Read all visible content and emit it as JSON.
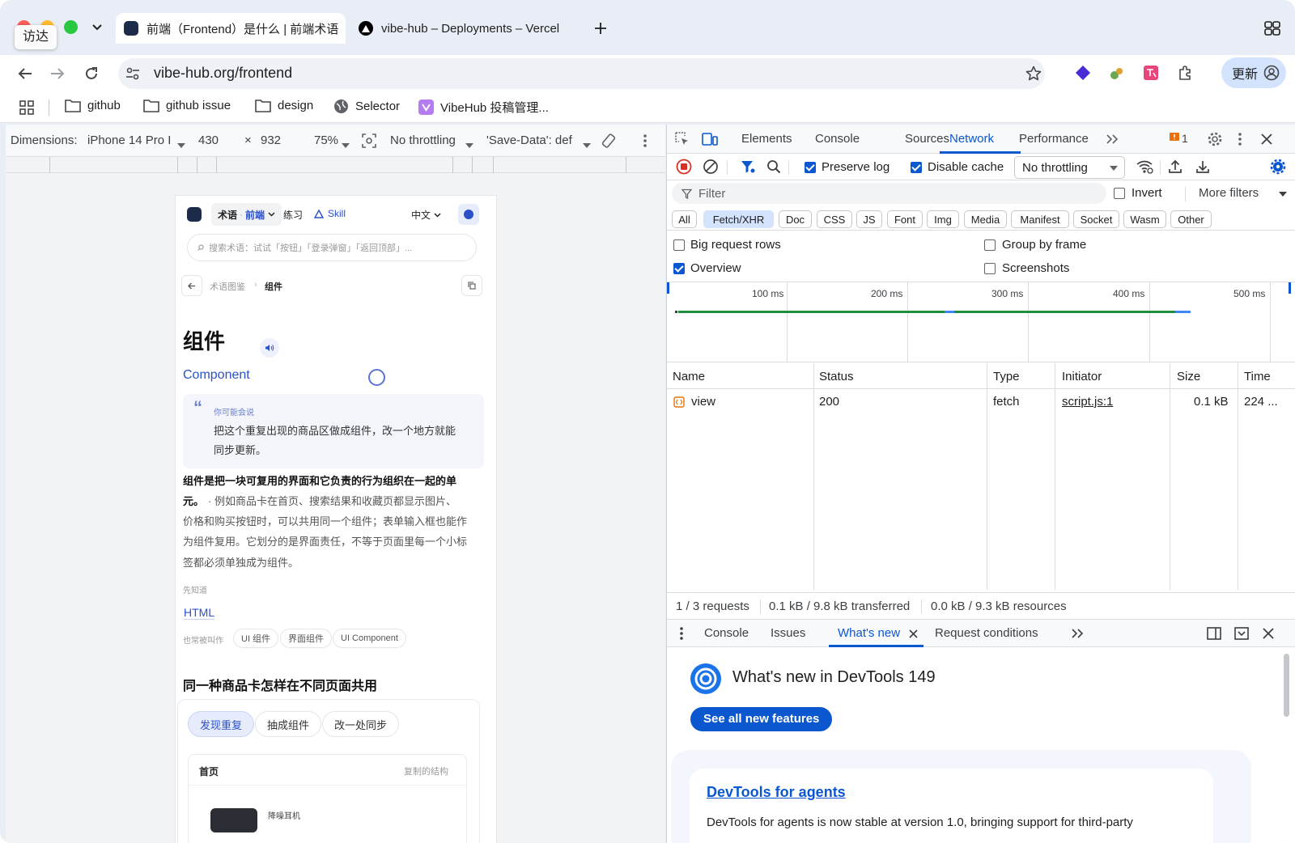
{
  "colors": {
    "accent": "#0b57d0",
    "close_red": "#ff5f57",
    "minimize_yellow": "#febc2e",
    "maximize_green": "#28c840",
    "record_red": "#d93025",
    "waterfall_green": "#1e8e3e"
  },
  "macos": {
    "finder_tooltip": "访达"
  },
  "tabs": [
    {
      "title": "前端（Frontend）是什么 | 前端术语",
      "icon": "vibehub-logo-icon"
    },
    {
      "title": "vibe-hub – Deployments – Vercel",
      "icon": "vercel-triangle-icon"
    }
  ],
  "toolbar": {
    "url": "vibe-hub.org/frontend",
    "update_label": "更新"
  },
  "bookmarks": [
    {
      "label": "github",
      "icon": "folder-icon"
    },
    {
      "label": "github issue",
      "icon": "folder-icon"
    },
    {
      "label": "design",
      "icon": "folder-icon"
    },
    {
      "label": "Selector",
      "icon": "globe-icon"
    },
    {
      "label": "VibeHub 投稿管理...",
      "icon": "vibehub-logo-icon"
    }
  ],
  "device_toolbar": {
    "dimensions_label": "Dimensions:",
    "device": "iPhone 14 Pro I",
    "width": "430",
    "times": "×",
    "height": "932",
    "zoom": "75%",
    "throttling": "No throttling",
    "save_data": "'Save-Data': def"
  },
  "device_page": {
    "nav_term": "术语",
    "nav_dot": "·",
    "nav_category": "前端",
    "nav_practice": "练习",
    "nav_skill": "Skill",
    "lang": "中文",
    "search_placeholder": "搜索术语：试试「按钮」「登录弹窗」「返回顶部」...",
    "breadcrumb_parent": "术语图鉴",
    "breadcrumb_sep": "›",
    "breadcrumb_current": "组件",
    "title": "组件",
    "english": "Component",
    "quote_mark": "“",
    "quote_label": "你可能会说",
    "quote_line1": "把这个重复出现的商品区做成组件，改一个地方就能",
    "quote_line2": "同步更新。",
    "def_bold1": "组件是把一块可复用的界面和它负责的行为组织在一起的单",
    "def_bold2": "元。",
    "def_line2_rest": "· 例如商品卡在首页、搜索结果和收藏页都显示图片、",
    "def_line3": "价格和购买按钮时，可以共用同一个组件；表单输入框也能作",
    "def_line4": "为组件复用。它划分的是界面责任，不等于页面里每一个小标",
    "def_line5": "签都必须单独成为组件。",
    "prereq_label": "先知道",
    "prereq_link": "HTML",
    "aka_label": "也常被叫作",
    "aka_chips": [
      "UI 组件",
      "界面组件",
      "UI Component"
    ],
    "section_title": "同一种商品卡怎样在不同页面共用",
    "steps": [
      "发现重复",
      "抽成组件",
      "改一处同步"
    ],
    "card_title": "首页",
    "card_note": "复制的结构",
    "card_item": "降噪耳机"
  },
  "devtools": {
    "tabs": [
      "Elements",
      "Console",
      "Sources",
      "Network",
      "Performance"
    ],
    "active_tab": "Network",
    "issues_count": "1",
    "preserve_log": "Preserve log",
    "disable_cache": "Disable cache",
    "throttling": "No throttling",
    "filter_placeholder": "Filter",
    "invert": "Invert",
    "more_filters": "More filters",
    "type_filters": [
      "All",
      "Fetch/XHR",
      "Doc",
      "CSS",
      "JS",
      "Font",
      "Img",
      "Media",
      "Manifest",
      "Socket",
      "Wasm",
      "Other"
    ],
    "selected_filter": "Fetch/XHR",
    "big_request_rows": "Big request rows",
    "group_by_frame": "Group by frame",
    "overview": "Overview",
    "screenshots": "Screenshots",
    "options": {
      "preserve_log": true,
      "disable_cache": true,
      "invert": false,
      "big_request_rows": false,
      "group_by_frame": false,
      "overview": true,
      "screenshots": false
    },
    "timeline_ticks": [
      "100 ms",
      "200 ms",
      "300 ms",
      "400 ms",
      "500 ms"
    ],
    "columns": [
      "Name",
      "Status",
      "Type",
      "Initiator",
      "Size",
      "Time"
    ],
    "rows": [
      {
        "name": "view",
        "status": "200",
        "type": "fetch",
        "initiator": "script.js:1",
        "size": "0.1 kB",
        "time": "224 ..."
      }
    ],
    "summary": {
      "requests": "1 / 3 requests",
      "transferred": "0.1 kB / 9.8 kB transferred",
      "resources": "0.0 kB / 9.3 kB resources"
    },
    "drawer_tabs": [
      "Console",
      "Issues",
      "What's new",
      "Request conditions"
    ],
    "active_drawer_tab": "What's new",
    "whats_new_title": "What's new in DevTools 149",
    "see_all_button": "See all new features",
    "article_title": "DevTools for agents",
    "article_text": "DevTools for agents is now stable at version 1.0, bringing support for third-party"
  }
}
